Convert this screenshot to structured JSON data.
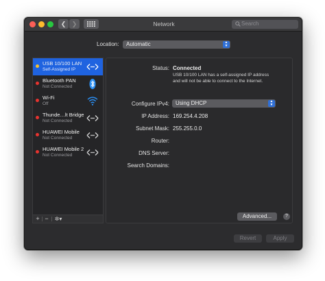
{
  "window": {
    "title": "Network"
  },
  "toolbar": {
    "back_icon": "chevron-left-icon",
    "forward_icon": "chevron-right-icon",
    "grid_icon": "grid-icon",
    "search_placeholder": "Search"
  },
  "location": {
    "label": "Location:",
    "value": "Automatic"
  },
  "services": [
    {
      "name": "USB 10/100 LAN",
      "status": "Self-Assigned IP",
      "dot_color": "#f5c12e",
      "icon": "ethernet-arrows-icon",
      "selected": true
    },
    {
      "name": "Bluetooth PAN",
      "status": "Not Connected",
      "dot_color": "#e8332f",
      "icon": "bluetooth-icon",
      "selected": false
    },
    {
      "name": "Wi-Fi",
      "status": "Off",
      "dot_color": "#e8332f",
      "icon": "wifi-icon",
      "selected": false
    },
    {
      "name": "Thunde…lt Bridge",
      "status": "Not Connected",
      "dot_color": "#e8332f",
      "icon": "ethernet-arrows-icon",
      "selected": false
    },
    {
      "name": "HUAWEI Mobile",
      "status": "Not Connected",
      "dot_color": "#e8332f",
      "icon": "ethernet-arrows-icon",
      "selected": false
    },
    {
      "name": "HUAWEI Mobile 2",
      "status": "Not Connected",
      "dot_color": "#e8332f",
      "icon": "ethernet-arrows-icon",
      "selected": false
    }
  ],
  "sidebar_tools": {
    "add": "+",
    "remove": "−",
    "actions": "✲▾"
  },
  "detail": {
    "status_label": "Status:",
    "status_value": "Connected",
    "status_note": "USB 10/100 LAN has a self-assigned IP address and will not be able to connect to the Internet.",
    "configure_label": "Configure IPv4:",
    "configure_value": "Using DHCP",
    "ip_label": "IP Address:",
    "ip_value": "169.254.4.208",
    "subnet_label": "Subnet Mask:",
    "subnet_value": "255.255.0.0",
    "router_label": "Router:",
    "dns_label": "DNS Server:",
    "search_domains_label": "Search Domains:",
    "advanced_button": "Advanced...",
    "help_button": "?"
  },
  "footer": {
    "revert": "Revert",
    "apply": "Apply"
  },
  "colors": {
    "accent": "#1f63e0",
    "window_bg": "#2c2c2e",
    "selected_row": "#1f63e0"
  }
}
